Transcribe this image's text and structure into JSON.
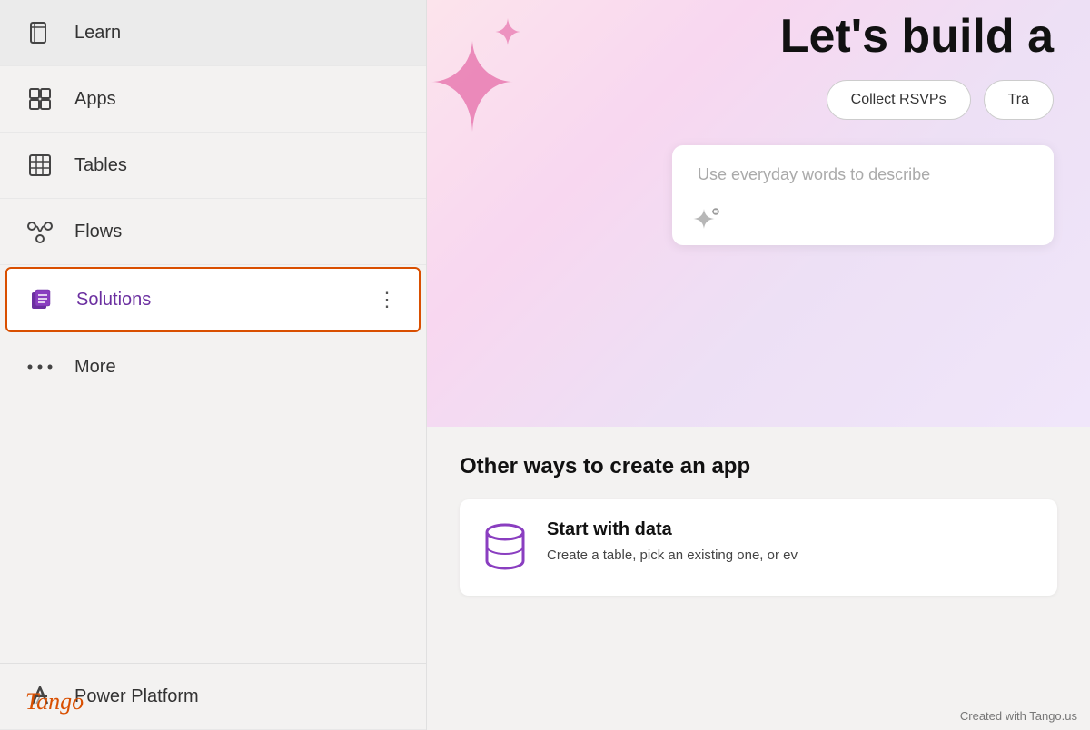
{
  "sidebar": {
    "items": [
      {
        "id": "learn",
        "label": "Learn",
        "icon": "book"
      },
      {
        "id": "apps",
        "label": "Apps",
        "icon": "grid-apps"
      },
      {
        "id": "tables",
        "label": "Tables",
        "icon": "table"
      },
      {
        "id": "flows",
        "label": "Flows",
        "icon": "flows"
      },
      {
        "id": "solutions",
        "label": "Solutions",
        "icon": "solutions",
        "active": true
      },
      {
        "id": "more",
        "label": "More",
        "icon": "dots"
      },
      {
        "id": "power-platform",
        "label": "Power Platform",
        "icon": "power-platform"
      }
    ]
  },
  "hero": {
    "title": "Let's build a",
    "buttons": [
      {
        "label": "Collect RSVPs"
      },
      {
        "label": "Tra"
      }
    ],
    "input_placeholder": "Use everyday words to describe"
  },
  "bottom": {
    "section_title": "Other ways to create an app",
    "card": {
      "title": "Start with data",
      "description": "Create a table, pick an existing one, or ev"
    }
  },
  "footer": {
    "tango_label": "Tango",
    "created_with": "Created with Tango.us"
  }
}
